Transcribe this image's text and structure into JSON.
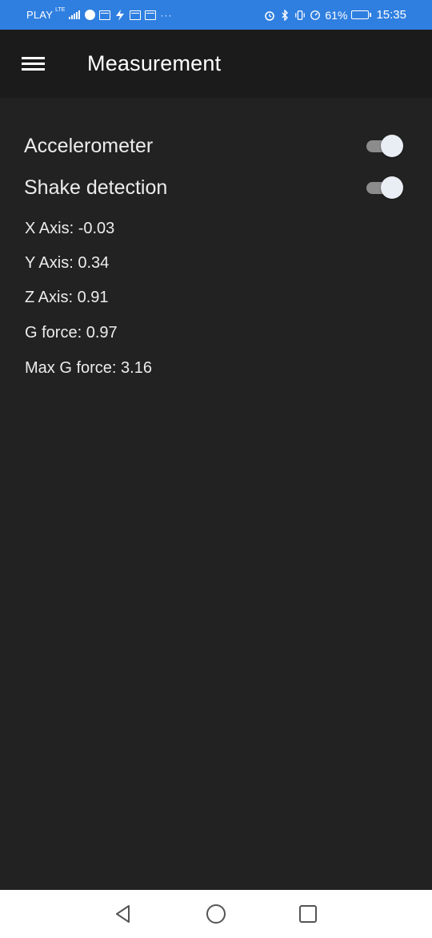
{
  "status_bar": {
    "carrier": "PLAY",
    "network": "LTE",
    "battery_percent": "61%",
    "battery_level": 0.61,
    "time": "15:35",
    "overflow": "···"
  },
  "app_bar": {
    "title": "Measurement",
    "menu_icon": "hamburger-menu-icon"
  },
  "toggles": [
    {
      "label": "Accelerometer",
      "on": true
    },
    {
      "label": "Shake detection",
      "on": true
    }
  ],
  "readings": {
    "x_axis": "X Axis: -0.03",
    "y_axis": "Y Axis: 0.34",
    "z_axis": "Z Axis: 0.91",
    "g_force": "G force: 0.97",
    "max_g_force": "Max G force: 3.16"
  },
  "nav_bar": {
    "back_icon": "back-triangle-icon",
    "home_icon": "home-circle-icon",
    "recents_icon": "recents-square-icon"
  },
  "colors": {
    "status_bar": "#2f7fe0",
    "app_bar": "#1b1b1b",
    "background": "#222222",
    "switch_track": "#8c8c8c",
    "switch_thumb": "#e9eef4"
  }
}
